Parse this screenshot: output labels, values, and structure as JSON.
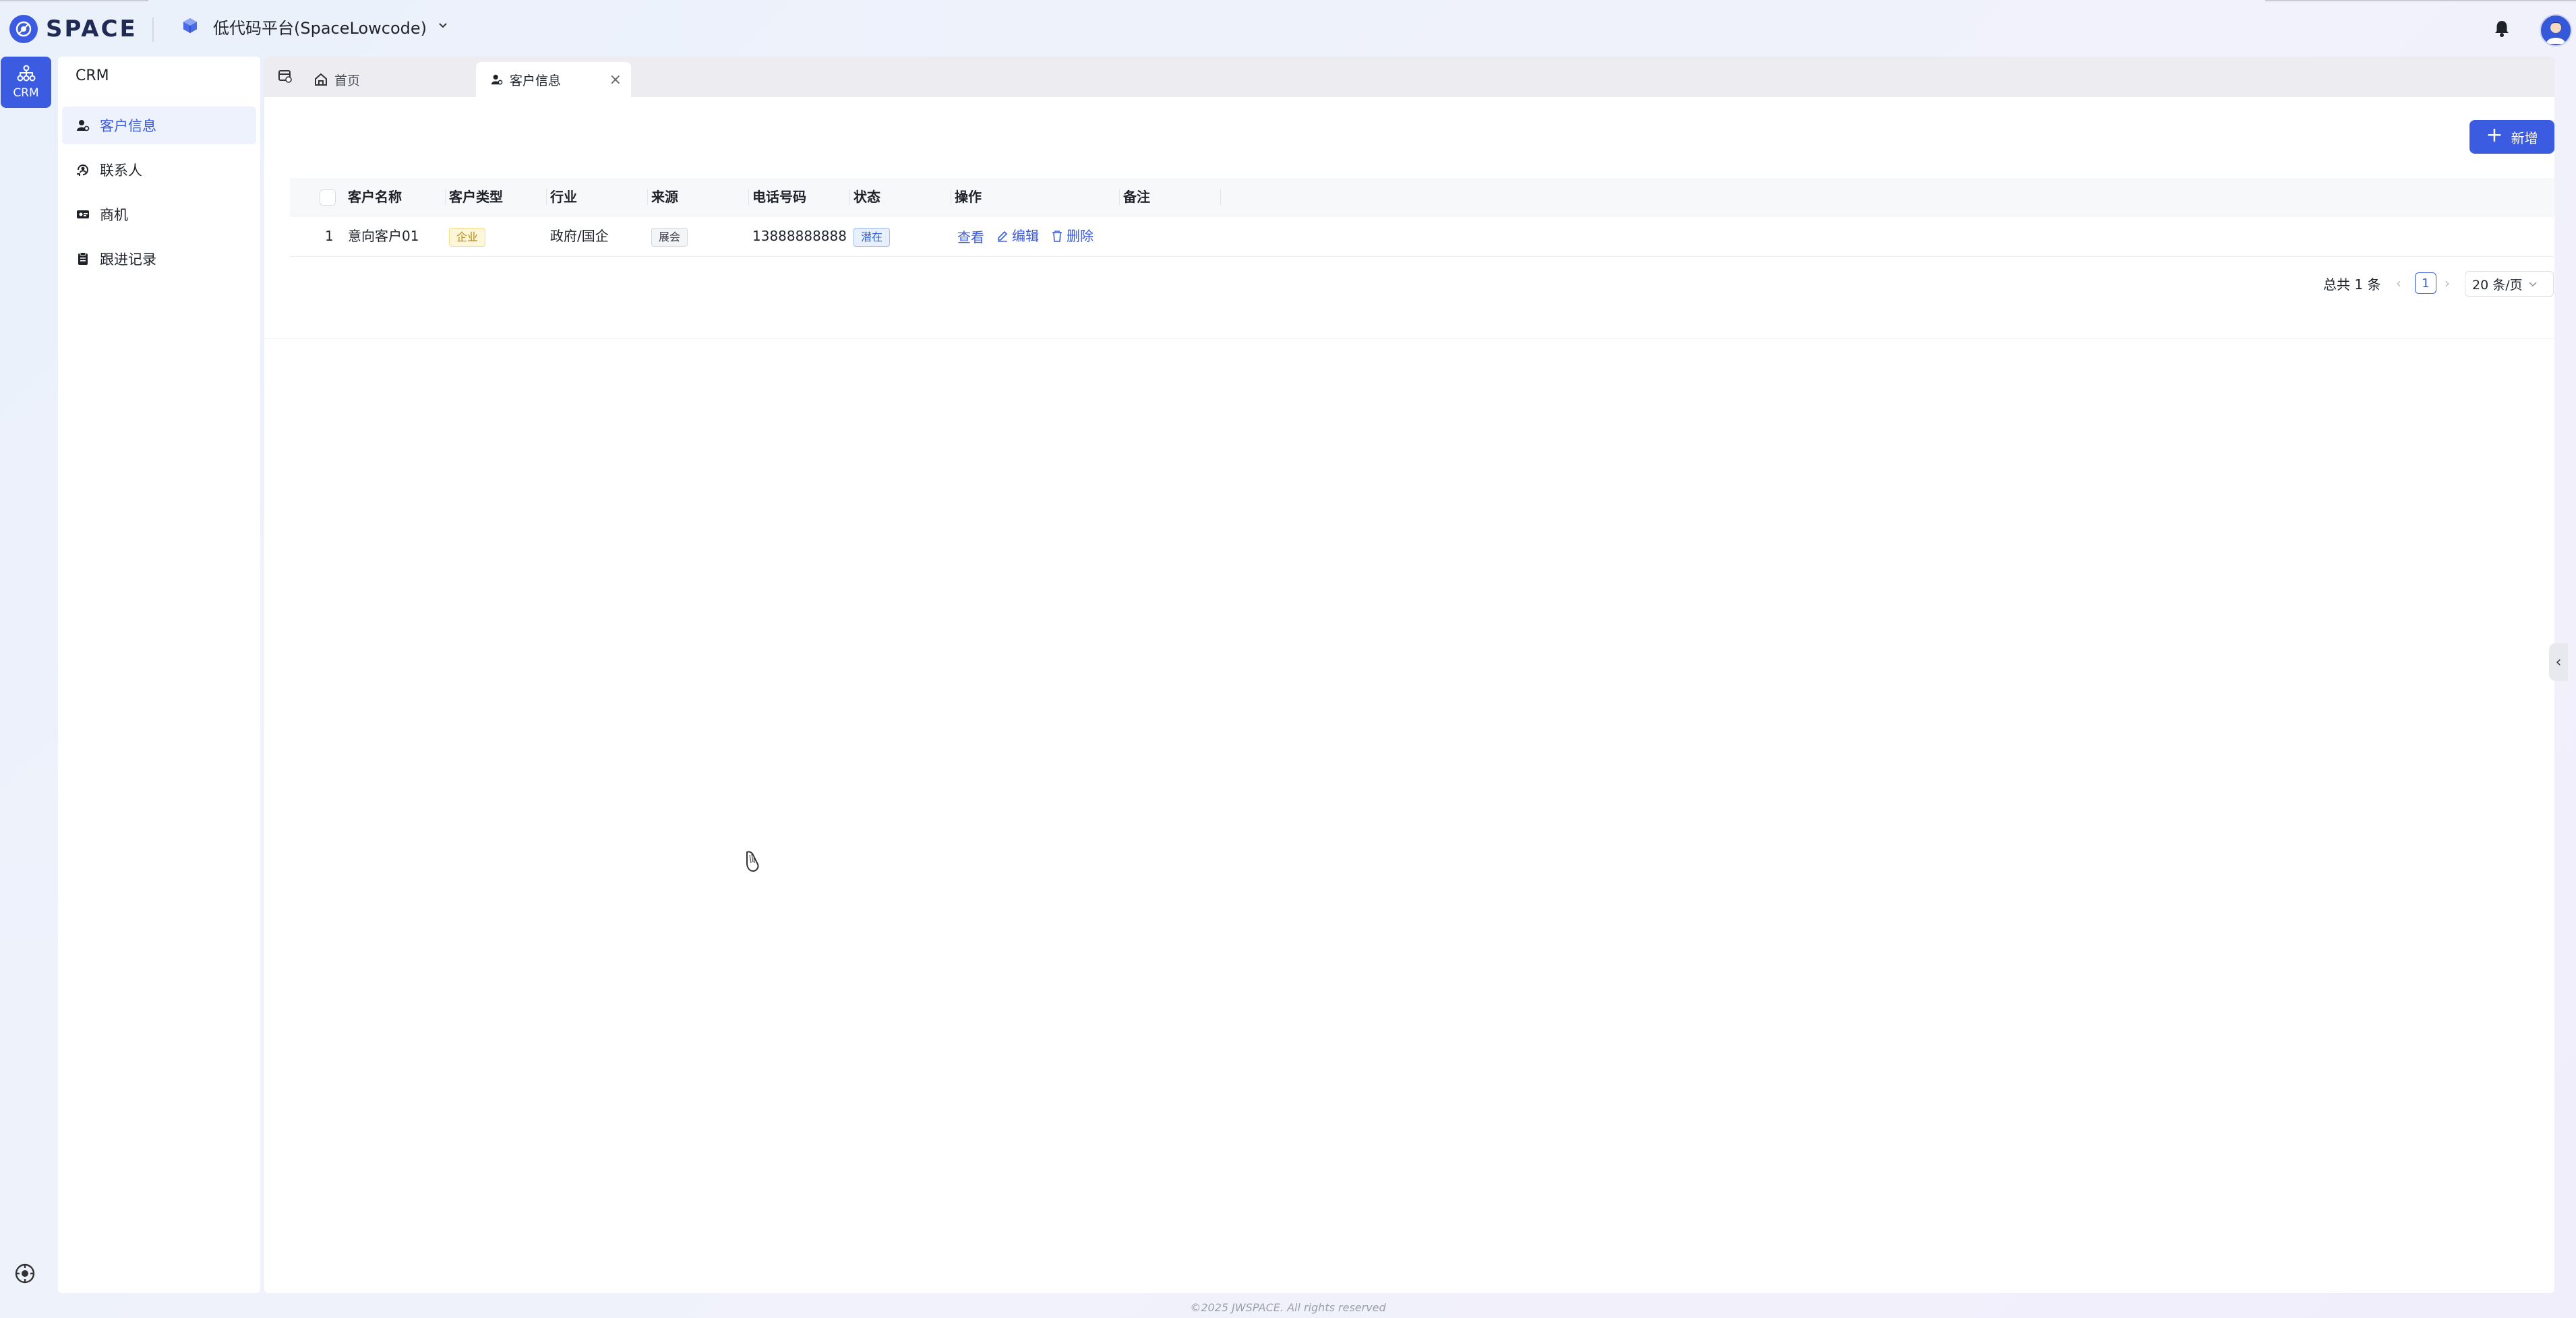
{
  "header": {
    "brand": "SPACE",
    "platform_title": "低代码平台(SpaceLowcode)",
    "icons": [
      "space-logo-icon",
      "platform-cube-icon",
      "chevron-down-icon",
      "bell-icon",
      "user-avatar"
    ]
  },
  "rail": {
    "app_label": "CRM"
  },
  "sidebar": {
    "title": "CRM",
    "items": [
      {
        "label": "客户信息",
        "icon": "customer-icon",
        "active": true
      },
      {
        "label": "联系人",
        "icon": "contact-icon",
        "active": false
      },
      {
        "label": "商机",
        "icon": "opportunity-icon",
        "active": false
      },
      {
        "label": "跟进记录",
        "icon": "followup-record-icon",
        "active": false
      }
    ]
  },
  "tabs": [
    {
      "label": "首页",
      "icon": "home-icon",
      "active": false
    },
    {
      "label": "客户信息",
      "icon": "customer-icon",
      "active": true
    }
  ],
  "toolbar": {
    "add_label": "新增"
  },
  "table": {
    "columns": [
      "客户名称",
      "客户类型",
      "行业",
      "来源",
      "电话号码",
      "状态",
      "操作",
      "备注"
    ],
    "rows": [
      {
        "index": "1",
        "name": "意向客户01",
        "type": "企业",
        "industry": "政府/国企",
        "source": "展会",
        "phone": "13888888888",
        "status": "潜在",
        "remark": ""
      }
    ],
    "actions": {
      "view": "查看",
      "edit": "编辑",
      "delete": "删除"
    }
  },
  "pagination": {
    "total_text": "总共 1 条",
    "current_page": "1",
    "page_size": "20 条/页"
  },
  "footer": {
    "copyright": "©2025 JWSPACE. All rights reserved"
  },
  "colors": {
    "primary": "#3b5be0",
    "tag_yellow": "#fdf6d8",
    "tag_blue": "#e8f0fe"
  }
}
